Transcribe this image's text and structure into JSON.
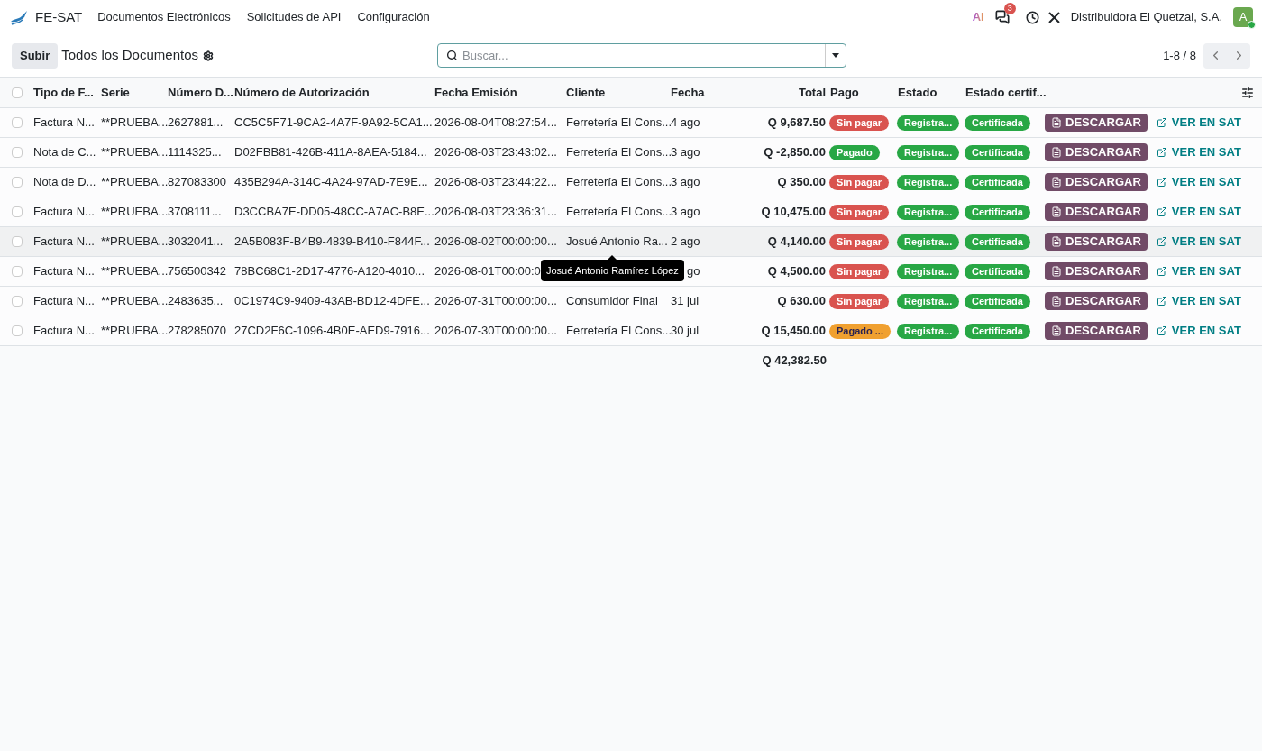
{
  "navbar": {
    "app_name": "FE-SAT",
    "menu": [
      "Documentos Electrónicos",
      "Solicitudes de API",
      "Configuración"
    ],
    "ai_label": "AI",
    "messages_count": "3",
    "company": "Distribuidora El Quetzal, S.A.",
    "avatar_letter": "A",
    "online": true
  },
  "control_panel": {
    "upload_button": "Subir",
    "title": "Todos los Documentos",
    "search": {
      "placeholder": "Buscar..."
    },
    "pager": "1-8 / 8"
  },
  "table": {
    "select_all_checked": false,
    "columns": [
      "Tipo de F...",
      "Serie",
      "Número D...",
      "Número de Autorización",
      "Fecha Emisión",
      "Cliente",
      "Fecha",
      "Total",
      "Pago",
      "Estado",
      "Estado certif..."
    ],
    "rows": [
      {
        "tipo": "Factura N...",
        "serie": "**PRUEBA...",
        "numero": "2627881...",
        "autorizacion": "CC5C5F71-9CA2-4A7F-9A92-5CA1...",
        "fecha_emision": "2026-08-04T08:27:54...",
        "cliente": "Ferretería El Cons...",
        "fecha": "4 ago",
        "total": "Q 9,687.50",
        "pago": {
          "label": "Sin pagar",
          "color": "#d9534f"
        },
        "estado": "Registra...",
        "certificado": "Certificada",
        "download": "DESCARGAR",
        "link": "VER EN SAT",
        "hovered": false,
        "checked": false
      },
      {
        "tipo": "Nota de C...",
        "serie": "**PRUEBA...",
        "numero": "1114325...",
        "autorizacion": "D02FBB81-426B-411A-8AEA-5184...",
        "fecha_emision": "2026-08-03T23:43:02...",
        "cliente": "Ferretería El Cons...",
        "fecha": "3 ago",
        "total": "Q -2,850.00",
        "pago": {
          "label": "Pagado",
          "color": "#28a745"
        },
        "estado": "Registra...",
        "certificado": "Certificada",
        "download": "DESCARGAR",
        "link": "VER EN SAT",
        "hovered": false,
        "checked": false
      },
      {
        "tipo": "Nota de D...",
        "serie": "**PRUEBA...",
        "numero": "827083300",
        "autorizacion": "435B294A-314C-4A24-97AD-7E9E...",
        "fecha_emision": "2026-08-03T23:44:22...",
        "cliente": "Ferretería El Cons...",
        "fecha": "3 ago",
        "total": "Q 350.00",
        "pago": {
          "label": "Sin pagar",
          "color": "#d9534f"
        },
        "estado": "Registra...",
        "certificado": "Certificada",
        "download": "DESCARGAR",
        "link": "VER EN SAT",
        "hovered": false,
        "checked": false
      },
      {
        "tipo": "Factura N...",
        "serie": "**PRUEBA...",
        "numero": "3708111...",
        "autorizacion": "D3CCBA7E-DD05-48CC-A7AC-B8E...",
        "fecha_emision": "2026-08-03T23:36:31...",
        "cliente": "Ferretería El Cons...",
        "fecha": "3 ago",
        "total": "Q 10,475.00",
        "pago": {
          "label": "Sin pagar",
          "color": "#d9534f"
        },
        "estado": "Registra...",
        "certificado": "Certificada",
        "download": "DESCARGAR",
        "link": "VER EN SAT",
        "hovered": false,
        "checked": false
      },
      {
        "tipo": "Factura N...",
        "serie": "**PRUEBA...",
        "numero": "3032041...",
        "autorizacion": "2A5B083F-B4B9-4839-B410-F844F...",
        "fecha_emision": "2026-08-02T00:00:00...",
        "cliente": "Josué Antonio Ra...",
        "fecha": "2 ago",
        "total": "Q 4,140.00",
        "pago": {
          "label": "Sin pagar",
          "color": "#d9534f"
        },
        "estado": "Registra...",
        "certificado": "Certificada",
        "download": "DESCARGAR",
        "link": "VER EN SAT",
        "hovered": true,
        "checked": false,
        "tooltip": "Josué Antonio Ramírez López"
      },
      {
        "tipo": "Factura N...",
        "serie": "**PRUEBA...",
        "numero": "756500342",
        "autorizacion": "78BC68C1-2D17-4776-A120-4010...",
        "fecha_emision": "2026-08-01T00:00:0",
        "fecha": "go",
        "total": "Q 4,500.00",
        "pago": {
          "label": "Sin pagar",
          "color": "#d9534f"
        },
        "estado": "Registra...",
        "certificado": "Certificada",
        "download": "DESCARGAR",
        "link": "VER EN SAT",
        "hovered": false,
        "checked": false
      },
      {
        "tipo": "Factura N...",
        "serie": "**PRUEBA...",
        "numero": "2483635...",
        "autorizacion": "0C1974C9-9409-43AB-BD12-4DFE...",
        "fecha_emision": "2026-07-31T00:00:00...",
        "cliente": "Consumidor Final",
        "fecha": "31 jul",
        "total": "Q 630.00",
        "pago": {
          "label": "Sin pagar",
          "color": "#d9534f"
        },
        "estado": "Registra...",
        "certificado": "Certificada",
        "download": "DESCARGAR",
        "link": "VER EN SAT",
        "hovered": false,
        "checked": false
      },
      {
        "tipo": "Factura N...",
        "serie": "**PRUEBA...",
        "numero": "278285070",
        "autorizacion": "27CD2F6C-1096-4B0E-AED9-7916...",
        "fecha_emision": "2026-07-30T00:00:00...",
        "cliente": "Ferretería El Cons...",
        "fecha": "30 jul",
        "total": "Q 15,450.00",
        "pago": {
          "label": "Pagado ...",
          "color": "#f0a030"
        },
        "estado": "Registra...",
        "certificado": "Certificada",
        "download": "DESCARGAR",
        "link": "VER EN SAT",
        "hovered": false,
        "checked": false
      }
    ],
    "sum_total": "Q 42,382.50"
  }
}
